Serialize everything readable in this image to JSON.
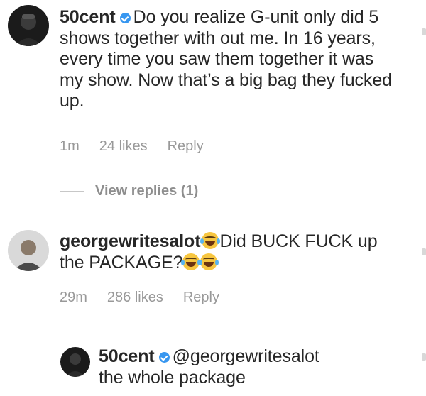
{
  "comments": [
    {
      "username": "50cent",
      "verified": true,
      "text": "Do you realize G-unit only did 5 shows together with out me. In 16 years, every time you saw them together it was my show. Now that’s a big bag they fucked up.",
      "time": "1m",
      "likes": "24 likes",
      "reply": "Reply"
    },
    {
      "username": "georgewritesalot",
      "text_part1": "Did BUCK FUCK up the PACKAGE?",
      "time": "29m",
      "likes": "286 likes",
      "reply": "Reply"
    }
  ],
  "view_replies": "View replies (1)",
  "reply_comment": {
    "username": "50cent",
    "verified": true,
    "mention": "@georgewritesalot",
    "text": "the whole package"
  },
  "icons": {
    "verified": "verified-badge-icon",
    "emoji": "face-with-tears-of-joy-icon",
    "like": "heart-icon"
  },
  "colors": {
    "verified": "#3897f0",
    "meta": "#999999",
    "text": "#262626"
  }
}
